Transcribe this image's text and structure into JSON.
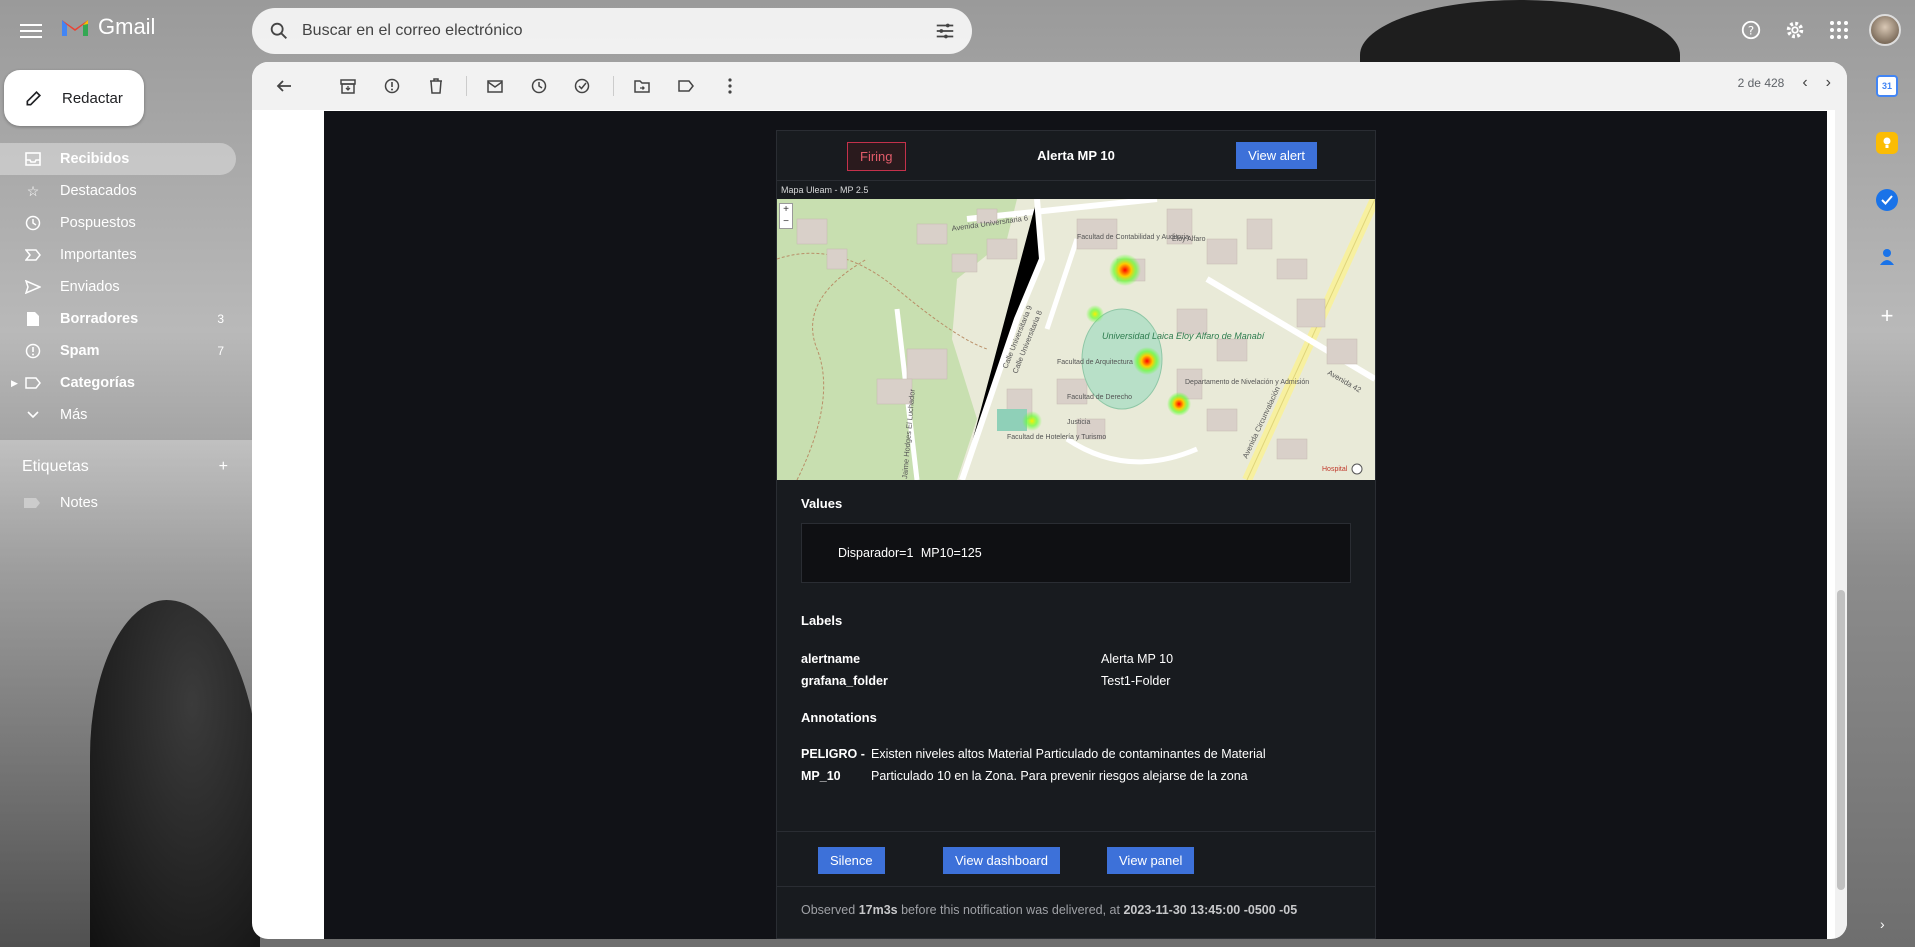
{
  "app": {
    "name": "Gmail",
    "search_placeholder": "Buscar en el correo electrónico"
  },
  "compose": {
    "label": "Redactar"
  },
  "nav": {
    "items": [
      {
        "label": "Recibidos",
        "icon": "inbox-icon",
        "count": ""
      },
      {
        "label": "Destacados",
        "icon": "star-icon",
        "count": ""
      },
      {
        "label": "Pospuestos",
        "icon": "clock-icon",
        "count": ""
      },
      {
        "label": "Importantes",
        "icon": "important-icon",
        "count": ""
      },
      {
        "label": "Enviados",
        "icon": "send-icon",
        "count": ""
      },
      {
        "label": "Borradores",
        "icon": "draft-icon",
        "count": "3"
      },
      {
        "label": "Spam",
        "icon": "spam-icon",
        "count": "7"
      },
      {
        "label": "Categorías",
        "icon": "label-icon",
        "count": ""
      },
      {
        "label": "Más",
        "icon": "chevron-down-icon",
        "count": ""
      }
    ],
    "labels_title": "Etiquetas",
    "labels": [
      {
        "label": "Notes"
      }
    ]
  },
  "toolbar": {
    "pager": "2 de 428"
  },
  "alert": {
    "status": "Firing",
    "title": "Alerta MP 10",
    "view_alert": "View alert",
    "map_title": "Mapa Uleam - MP 2.5",
    "map_labels": {
      "street1": "Avenida Universitaria 6",
      "street2": "Calle Universitaria 9",
      "street3": "Calle Universitaria 8",
      "fac_contab": "Facultad de Contabilidad y Auditoria",
      "fac_arq": "Facultad de Arquitectura",
      "fac_der": "Facultad de Derecho",
      "fac_hot": "Facultad de Hotelería y Turismo",
      "univ": "Universidad Laica Eloy Alfaro de Manabí",
      "depto": "Departamento de Nivelación y Admisión",
      "av_circ": "Avenida Circunvalación",
      "av42": "Avenida 42",
      "justicia": "Justicia",
      "hospital": "Hospital",
      "hodges": "Jaime Hodges El Luchador",
      "eloy": "Eloy Alfaro"
    },
    "values_title": "Values",
    "values_text": "Disparador=1  MP10=125",
    "labels_title": "Labels",
    "labels": [
      {
        "key": "alertname",
        "value": "Alerta MP 10"
      },
      {
        "key": "grafana_folder",
        "value": "Test1-Folder"
      }
    ],
    "annotations_title": "Annotations",
    "annotation_key_1": "PELIGRO -",
    "annotation_key_2": "MP_10",
    "annotation_line_1": "Existen niveles altos Material Particulado de contaminantes de Material",
    "annotation_line_2": "Particulado 10 en la Zona. Para prevenir riesgos alejarse de la zona",
    "buttons": {
      "silence": "Silence",
      "dashboard": "View dashboard",
      "panel": "View panel"
    },
    "observed_prefix": "Observed",
    "observed_duration": "17m3s",
    "observed_mid": "before this notification was delivered, at",
    "observed_time": "2023-11-30 13:45:00 -0500 -05"
  },
  "colors": {
    "accent_blue": "#3d71d9",
    "firing_red": "#e25c6a",
    "email_bg": "#111217",
    "card_bg": "#181b1f"
  },
  "rail": {
    "calendar_day": "31"
  }
}
